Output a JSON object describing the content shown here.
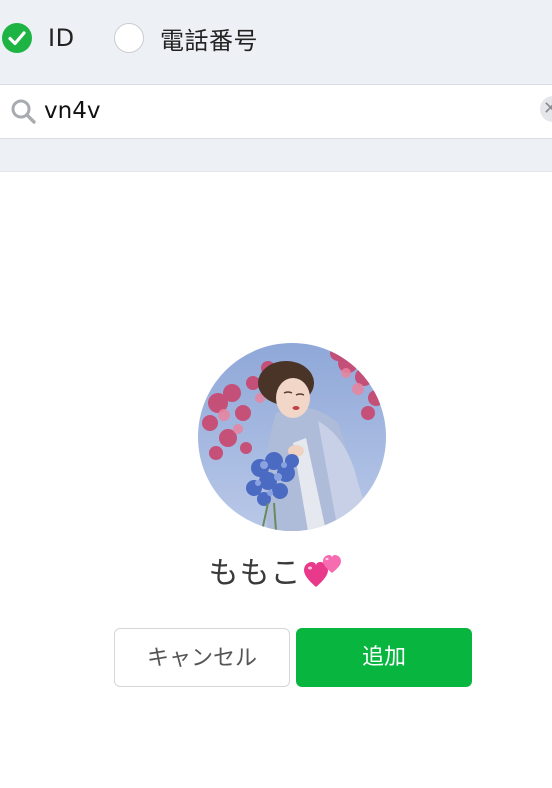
{
  "search_type": {
    "options": [
      {
        "label": "ID",
        "selected": true
      },
      {
        "label": "電話番号",
        "selected": false
      }
    ]
  },
  "search": {
    "value": "vn4v",
    "clear_icon": "clear-icon"
  },
  "result": {
    "name": "ももこ",
    "name_emoji": "hearts-icon",
    "avatar": "profile-photo"
  },
  "actions": {
    "cancel_label": "キャンセル",
    "add_label": "追加"
  },
  "colors": {
    "accent_green": "#08b63f",
    "radio_green": "#1db444",
    "bar_background": "#edf0f4"
  }
}
